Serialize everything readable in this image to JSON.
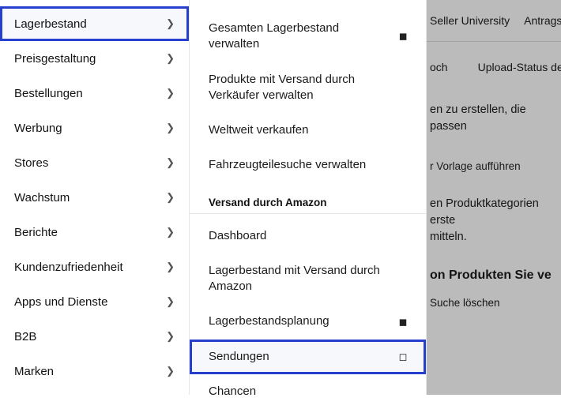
{
  "sidebar": {
    "items": [
      {
        "label": "Lagerbestand",
        "highlight": true
      },
      {
        "label": "Preisgestaltung"
      },
      {
        "label": "Bestellungen"
      },
      {
        "label": "Werbung"
      },
      {
        "label": "Stores"
      },
      {
        "label": "Wachstum"
      },
      {
        "label": "Berichte"
      },
      {
        "label": "Kundenzufriedenheit"
      },
      {
        "label": "Apps und Dienste"
      },
      {
        "label": "B2B"
      },
      {
        "label": "Marken"
      }
    ]
  },
  "submenu": {
    "items_top": [
      {
        "label": "Gesamten Lagerbestand verwalten",
        "bookmark": "filled"
      },
      {
        "label": "Produkte mit Versand durch Verkäufer verwalten"
      },
      {
        "label": "Weltweit verkaufen"
      },
      {
        "label": "Fahrzeugteilesuche verwalten"
      }
    ],
    "section_label": "Versand durch Amazon",
    "items_bottom": [
      {
        "label": "Dashboard"
      },
      {
        "label": "Lagerbestand mit Versand durch Amazon"
      },
      {
        "label": "Lagerbestandsplanung",
        "bookmark": "filled"
      },
      {
        "label": "Sendungen",
        "bookmark": "outline",
        "highlight": true
      },
      {
        "label": "Chancen"
      }
    ]
  },
  "background": {
    "topnav": {
      "a": "Seller University",
      "b": "Antragss"
    },
    "tabs": {
      "a": "och",
      "b": "Upload-Status de"
    },
    "line1": "en zu erstellen, die passen",
    "line2": "r Vorlage aufführen",
    "line3": "en Produktkategorien erste",
    "line4": "mitteln.",
    "bold": "on Produkten Sie ve",
    "clear": "Suche löschen"
  }
}
